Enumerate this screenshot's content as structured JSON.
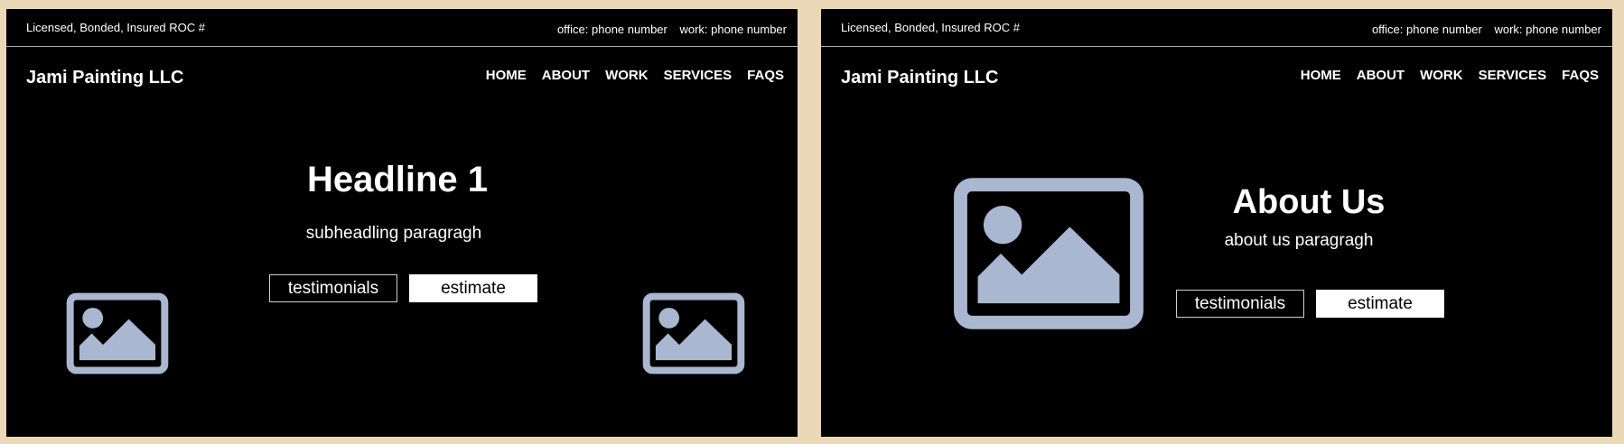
{
  "colors": {
    "page_background": "#ead8b7",
    "frame_background": "#000000",
    "text": "#ffffff",
    "placeholder_icon": "#a9b7d0"
  },
  "header": {
    "license_text": "Licensed, Bonded, Insured ROC #",
    "office_phone": "office: phone number",
    "work_phone": "work: phone number",
    "brand": "Jami Painting LLC",
    "nav": [
      "HOME",
      "ABOUT",
      "WORK",
      "SERVICES",
      "FAQS"
    ]
  },
  "home": {
    "headline": "Headline 1",
    "subheading": "subheadling paragragh",
    "testimonials_label": "testimonials",
    "estimate_label": "estimate",
    "image_icon": "image-placeholder-icon"
  },
  "about": {
    "headline": "About Us",
    "paragraph": "about us paragragh",
    "testimonials_label": "testimonials",
    "estimate_label": "estimate",
    "image_icon": "image-placeholder-icon"
  }
}
